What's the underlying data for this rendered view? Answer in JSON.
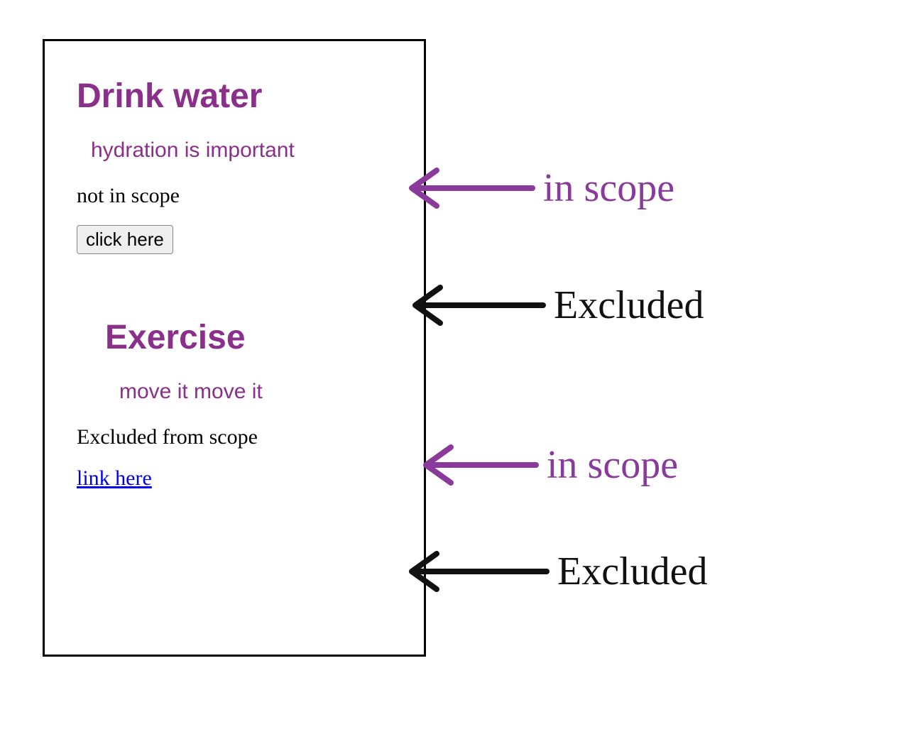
{
  "box": {
    "section1": {
      "heading": "Drink water",
      "subheading": "hydration is important",
      "body": "not in scope",
      "button_label": "click here"
    },
    "section2": {
      "heading": "Exercise",
      "subheading": "move it move it",
      "body": "Excluded from scope",
      "link_label": "link here"
    }
  },
  "annotations": {
    "a1": "in scope",
    "a2": "Excluded",
    "a3": "in scope",
    "a4": "Excluded"
  },
  "colors": {
    "scope_purple": "#8a3a9a",
    "excluded_black": "#111111",
    "link_blue": "#0000ee"
  }
}
